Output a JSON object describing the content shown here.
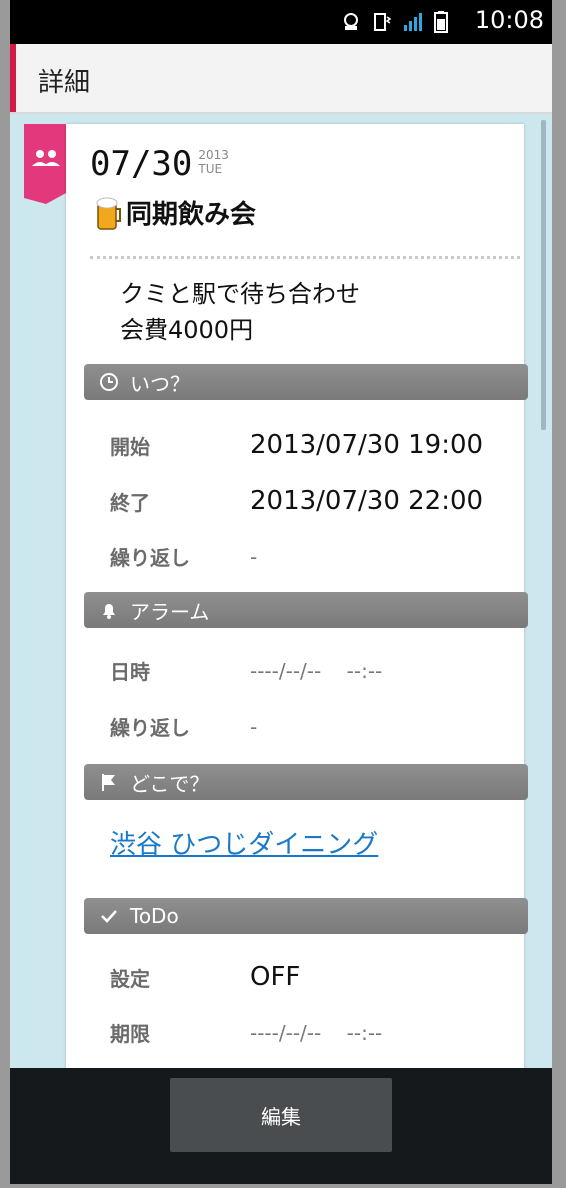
{
  "status_bar": {
    "time": "10:08"
  },
  "action_bar": {
    "title": "詳細"
  },
  "event": {
    "date": "07/30",
    "year": "2013",
    "weekday": "TUE",
    "title": "同期飲み会",
    "memo_lines": [
      "クミと駅で待ち合わせ",
      "会費4000円"
    ]
  },
  "when": {
    "header": "いつ？",
    "start_label": "開始",
    "start_value": "2013/07/30 19:00",
    "end_label": "終了",
    "end_value": "2013/07/30 22:00",
    "repeat_label": "繰り返し",
    "repeat_value": "-"
  },
  "alarm": {
    "header": "アラーム",
    "datetime_label": "日時",
    "datetime_value": "----/--/--    --:--",
    "repeat_label": "繰り返し",
    "repeat_value": "-"
  },
  "where": {
    "header": "どこで？",
    "place": "渋谷 ひつじダイニング"
  },
  "todo": {
    "header": "ToDo",
    "setting_label": "設定",
    "setting_value": "OFF",
    "deadline_label": "期限",
    "deadline_value": "----/--/--    --:--"
  },
  "bottom": {
    "edit_label": "編集"
  },
  "colors": {
    "accent": "#d01d48",
    "tag": "#e3397c",
    "link": "#1a78c8",
    "content_bg": "#cde7ef"
  }
}
